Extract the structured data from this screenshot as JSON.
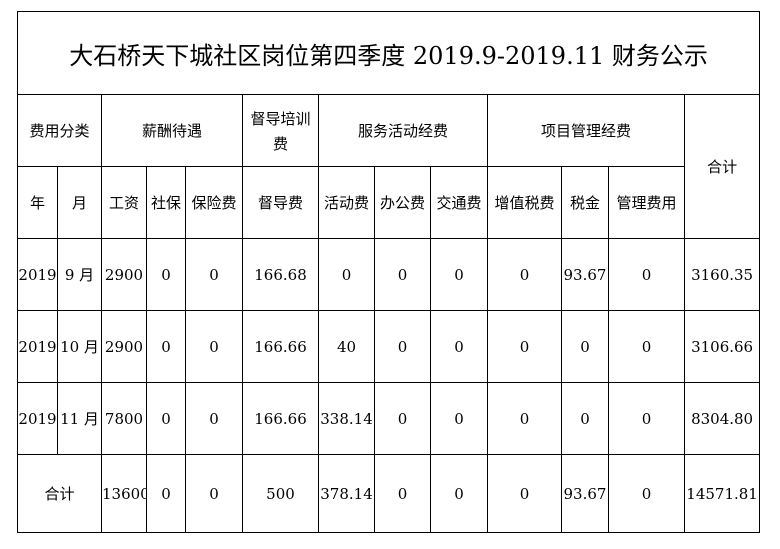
{
  "title": "大石桥天下城社区岗位第四季度 2019.9-2019.11 财务公示",
  "header1": {
    "category": "费用分类",
    "salary": "薪酬待遇",
    "supervision_line1": "督导培训",
    "supervision_line2": "费",
    "service": "服务活动经费",
    "project": "项目管理经费",
    "total": "合计"
  },
  "header2": [
    "年",
    "月",
    "工资",
    "社保",
    "保险费",
    "督导费",
    "活动费",
    "办公费",
    "交通费",
    "增值税费",
    "税金",
    "管理费用"
  ],
  "rows": [
    {
      "year": "2019",
      "month": "9 月",
      "wage": "2900",
      "social": "0",
      "insurance": "0",
      "supervision": "166.68",
      "activity": "0",
      "office": "0",
      "transport": "0",
      "vat": "0",
      "tax": "93.67",
      "mgmt": "0",
      "total": "3160.35"
    },
    {
      "year": "2019",
      "month": "10 月",
      "wage": "2900",
      "social": "0",
      "insurance": "0",
      "supervision": "166.66",
      "activity": "40",
      "office": "0",
      "transport": "0",
      "vat": "0",
      "tax": "0",
      "mgmt": "0",
      "total": "3106.66"
    },
    {
      "year": "2019",
      "month": "11 月",
      "wage": "7800",
      "social": "0",
      "insurance": "0",
      "supervision": "166.66",
      "activity": "338.14",
      "office": "0",
      "transport": "0",
      "vat": "0",
      "tax": "0",
      "mgmt": "0",
      "total": "8304.80"
    }
  ],
  "totals": {
    "label": "合计",
    "wage": "13600",
    "social": "0",
    "insurance": "0",
    "supervision": "500",
    "activity": "378.14",
    "office": "0",
    "transport": "0",
    "vat": "0",
    "tax": "93.67",
    "mgmt": "0",
    "total": "14571.81"
  }
}
